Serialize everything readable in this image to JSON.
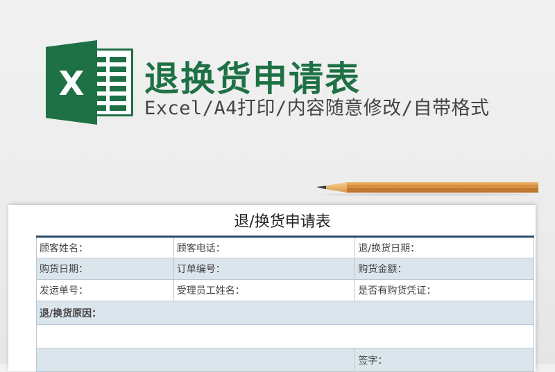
{
  "banner": {
    "title": "退换货申请表",
    "subtitle": "Excel/A4打印/内容随意修改/自带格式",
    "logo_letter": "X",
    "brand_color": "#1e7145"
  },
  "form": {
    "title": "退/换货申请表",
    "rows": [
      [
        "顾客姓名：",
        "顾客电话：",
        "退/换货日期："
      ],
      [
        "购货日期：",
        "订单编号：",
        "购货金额："
      ],
      [
        "发运单号：",
        "受理员工姓名：",
        "是否有购货凭证："
      ]
    ],
    "reason_label": "退/换货原因：",
    "signature_label": "签字："
  }
}
